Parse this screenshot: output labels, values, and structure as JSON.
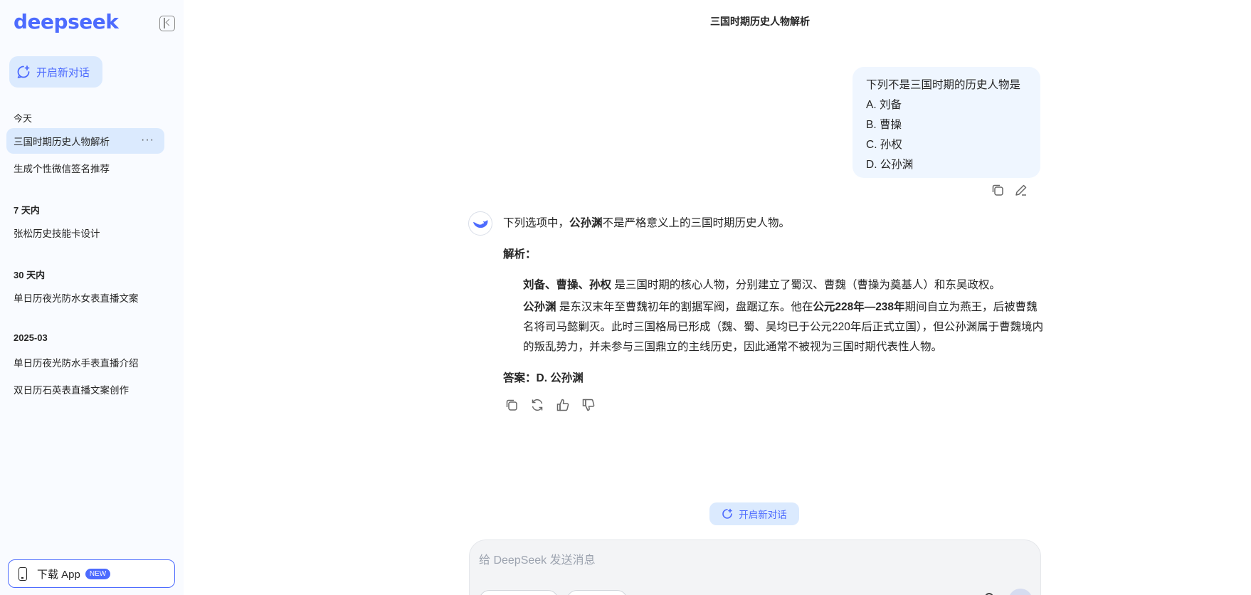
{
  "sidebar": {
    "logo": "deepseek",
    "new_chat_label": "开启新对话",
    "groups": [
      {
        "label": "今天",
        "items": [
          "三国时期历史人物解析",
          "生成个性微信签名推荐"
        ]
      },
      {
        "label": "7 天内",
        "items": [
          "张松历史技能卡设计"
        ]
      },
      {
        "label": "30 天内",
        "items": [
          "单日历夜光防水女表直播文案"
        ]
      },
      {
        "label": "2025-03",
        "items": [
          "单日历夜光防水手表直播介绍",
          "双日历石英表直播文案创作"
        ]
      }
    ],
    "more_label": "···",
    "download_label": "下载 App",
    "download_badge": "NEW"
  },
  "header": {
    "title": "三国时期历史人物解析"
  },
  "user_message": {
    "lines": [
      "下列不是三国时期的历史人物是",
      "A. 刘备",
      "B. 曹操",
      "C. 孙权",
      "D. 公孙渊"
    ]
  },
  "ai_message": {
    "intro_before": "下列选项中，",
    "intro_bold": "公孙渊",
    "intro_after": "不是严格意义上的三国时期历史人物。",
    "analysis_heading": "解析：",
    "p1_bold": "刘备、曹操、孙权",
    "p1_text": " 是三国时期的核心人物，分别建立了蜀汉、曹魏（曹操为奠基人）和东吴政权。",
    "p2_bold1": "公孙渊",
    "p2_text1": " 是东汉末年至曹魏初年的割据军阀，盘踞辽东。他在",
    "p2_bold2": "公元228年—238年",
    "p2_text2": "期间自立为燕王，后被曹魏名将司马懿剿灭。此时三国格局已形成（魏、蜀、吴均已于公元220年后正式立国），但公孙渊属于曹魏境内的叛乱势力，并未参与三国鼎立的主线历史，因此通常不被视为三国时期代表性人物。",
    "answer": "答案：D. 公孙渊"
  },
  "new_chat_pill": "开启新对话",
  "input": {
    "placeholder": "给 DeepSeek 发送消息"
  },
  "colors": {
    "accent": "#4d6bfe",
    "active_bg": "#dbeafe",
    "sidebar_bg": "#f9fbff"
  }
}
